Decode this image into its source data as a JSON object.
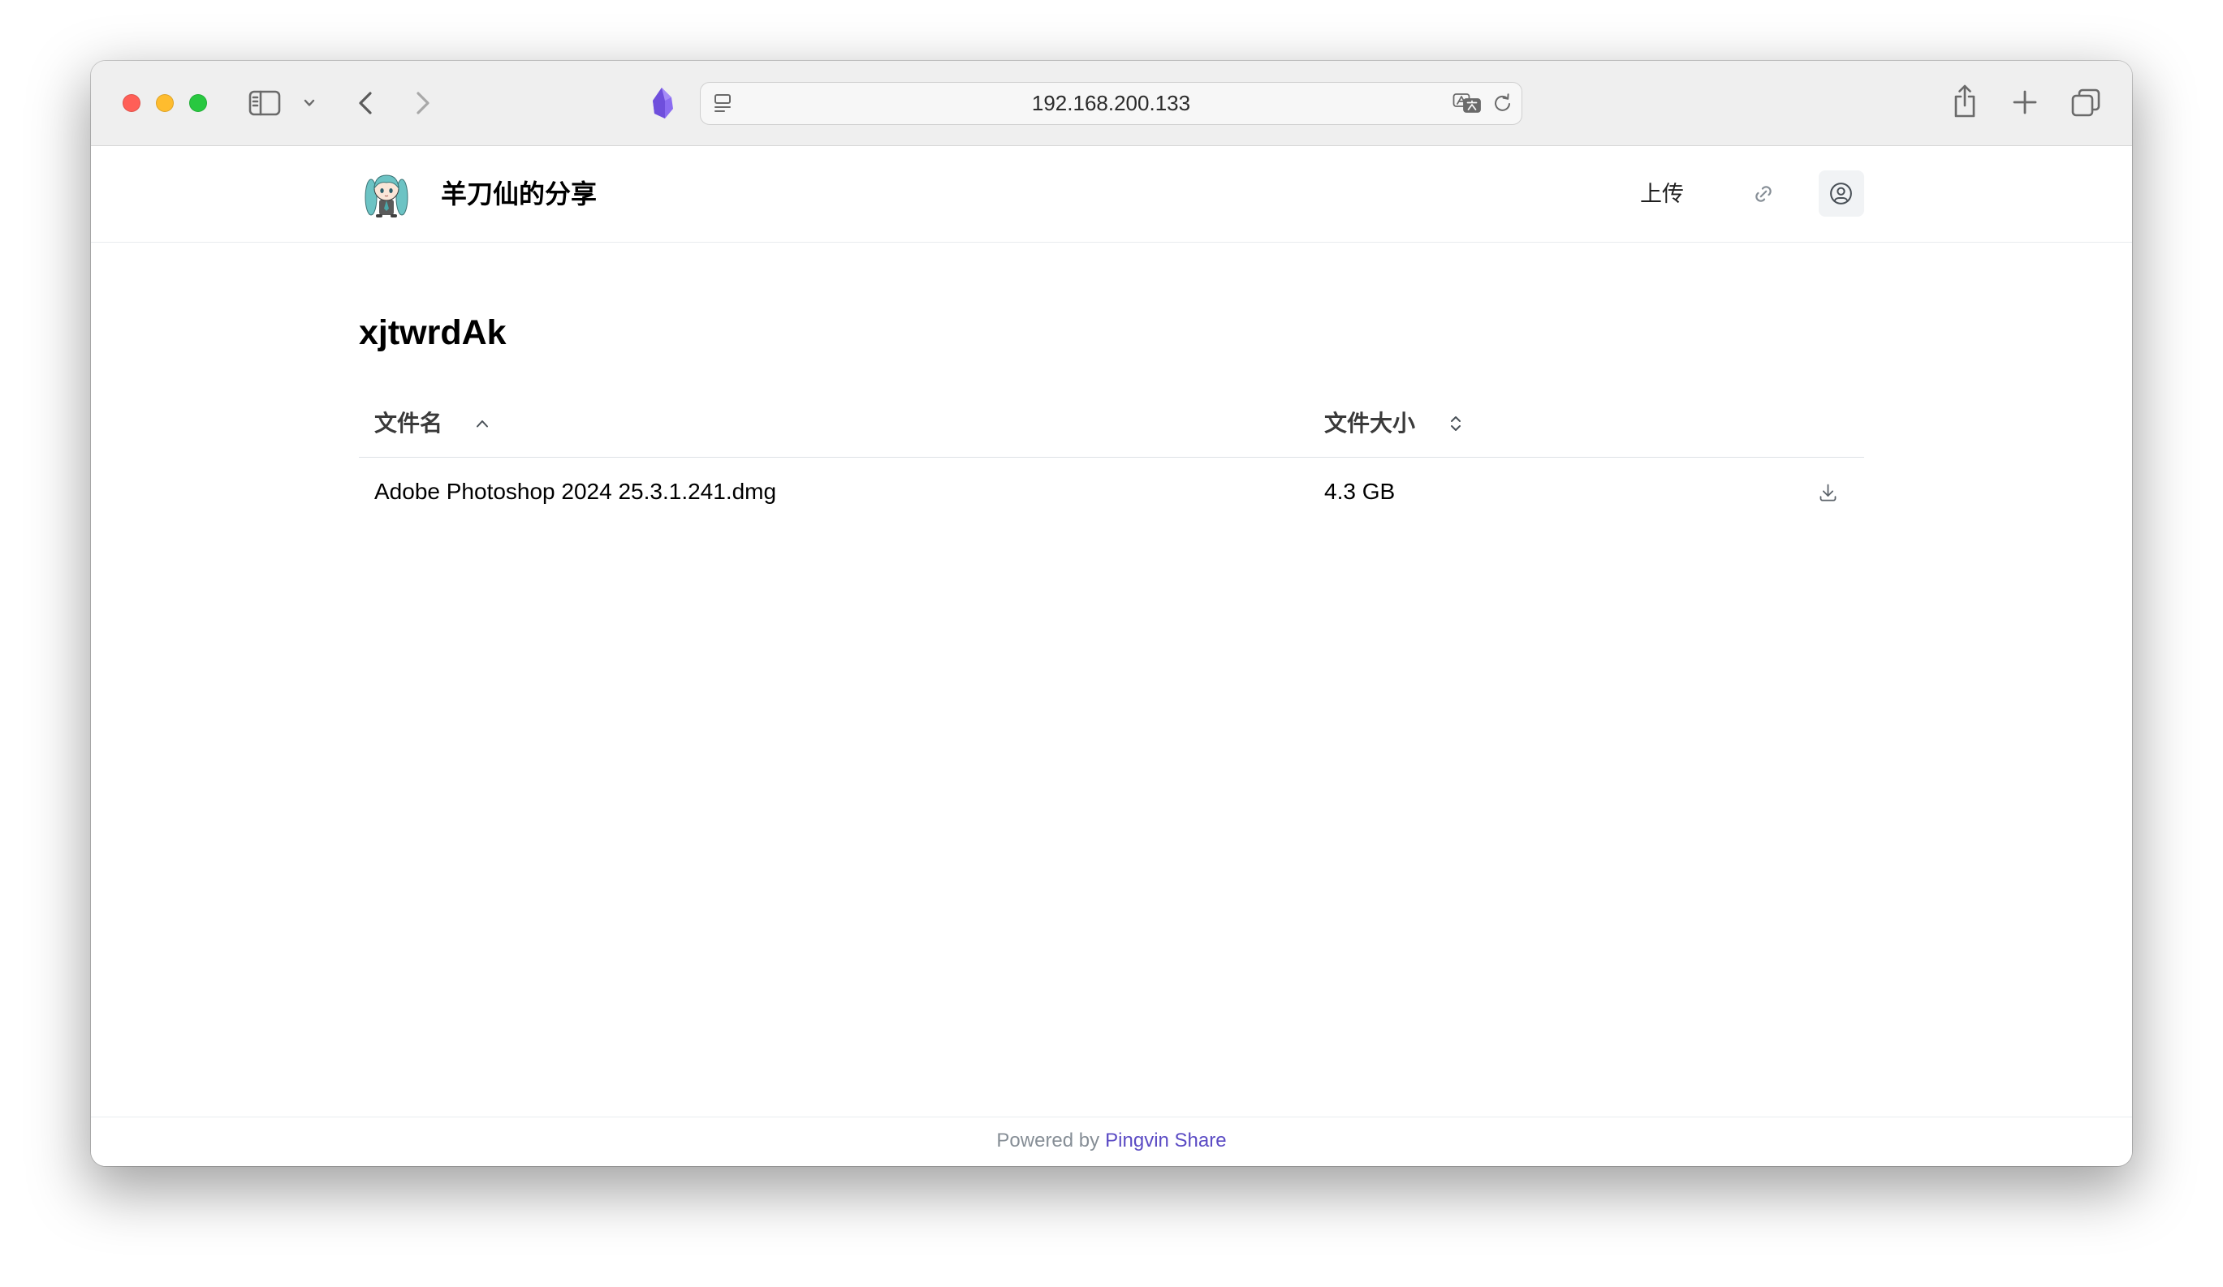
{
  "browser": {
    "address": "192.168.200.133"
  },
  "header": {
    "site_title": "羊刀仙的分享",
    "upload_label": "上传"
  },
  "share": {
    "title": "xjtwrdAk",
    "columns": {
      "name": "文件名",
      "size": "文件大小"
    },
    "files": [
      {
        "name": "Adobe Photoshop 2024 25.3.1.241.dmg",
        "size": "4.3 GB"
      }
    ]
  },
  "footer": {
    "powered_by": "Powered by",
    "link_text": "Pingvin Share"
  },
  "icons": {
    "window_controls": [
      "close-icon",
      "minimize-icon",
      "zoom-icon"
    ],
    "toolbar": [
      "sidebar-icon",
      "chevron-down-icon",
      "back-icon",
      "forward-icon",
      "extension-gem-icon",
      "page-menu-icon",
      "translate-icon",
      "reload-icon",
      "share-icon",
      "plus-icon",
      "tab-overview-icon"
    ],
    "header": [
      "avatar-icon",
      "link-icon",
      "user-circle-icon"
    ],
    "table": [
      "chevron-up-icon",
      "selector-icon",
      "download-icon"
    ]
  },
  "colors": {
    "accent": "#5b4bc4",
    "brand_purple": "#8b6cf1",
    "traffic_red": "#ff5f57",
    "traffic_yellow": "#febc2e",
    "traffic_green": "#28c840"
  }
}
